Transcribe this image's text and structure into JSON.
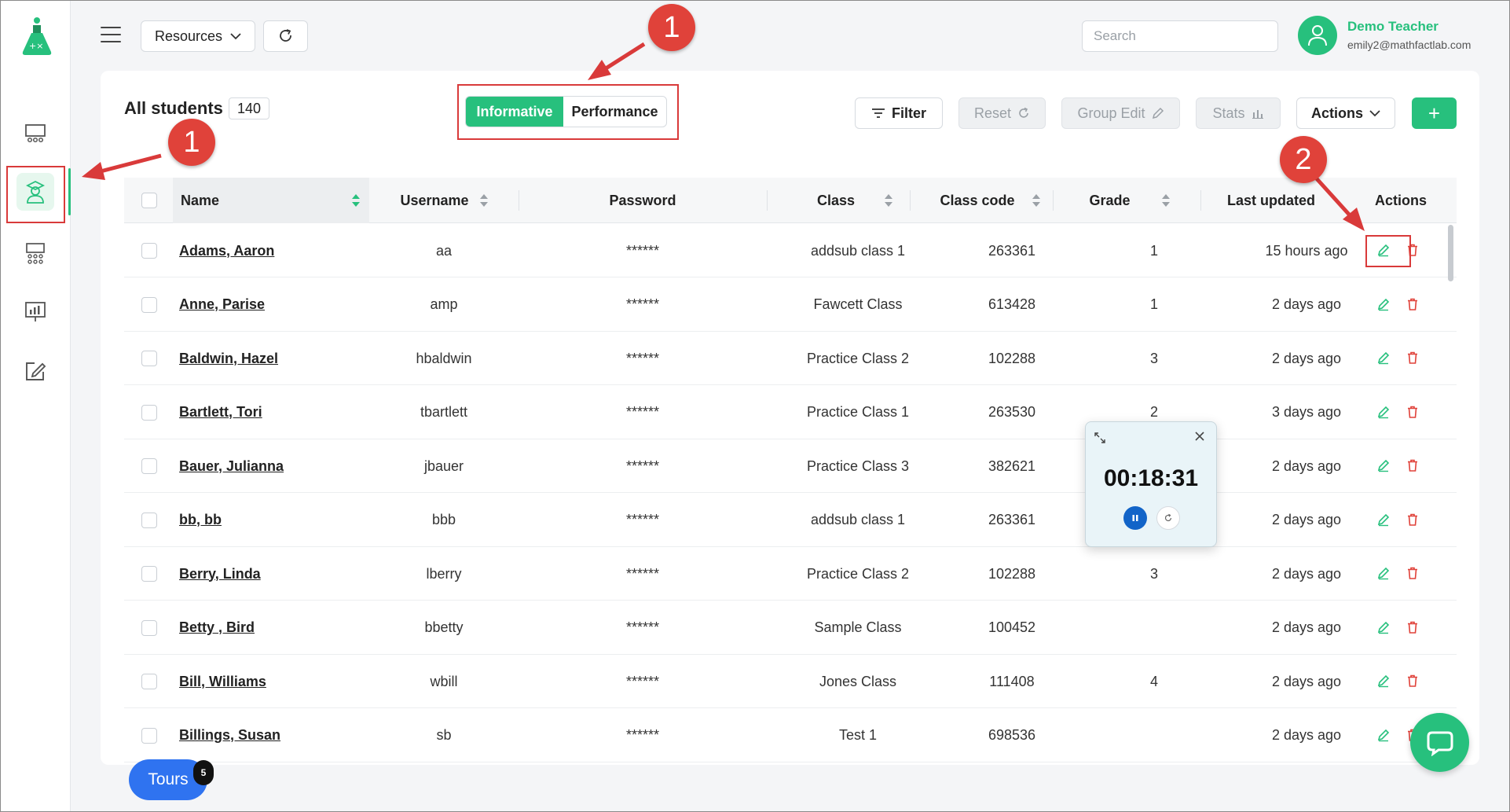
{
  "header": {
    "resources_label": "Resources",
    "search_placeholder": "Search",
    "user_name": "Demo Teacher",
    "user_email": "emily2@mathfactlab.com"
  },
  "students": {
    "title": "All students",
    "count": "140",
    "view_tabs": [
      "Informative",
      "Performance"
    ],
    "active_tab": "Informative"
  },
  "toolbar": {
    "filter": "Filter",
    "reset": "Reset",
    "group_edit": "Group Edit",
    "stats": "Stats",
    "actions": "Actions",
    "add": "+"
  },
  "table": {
    "columns": [
      "Name",
      "Username",
      "Password",
      "Class",
      "Class code",
      "Grade",
      "Last updated",
      "Actions"
    ],
    "rows": [
      {
        "name": "Adams, Aaron",
        "username": "aa",
        "password": "******",
        "class": "addsub class 1",
        "code": "263361",
        "grade": "1",
        "updated": "15 hours ago"
      },
      {
        "name": "Anne, Parise",
        "username": "amp",
        "password": "******",
        "class": "Fawcett Class",
        "code": "613428",
        "grade": "1",
        "updated": "2 days ago"
      },
      {
        "name": "Baldwin, Hazel",
        "username": "hbaldwin",
        "password": "******",
        "class": "Practice Class 2",
        "code": "102288",
        "grade": "3",
        "updated": "2 days ago"
      },
      {
        "name": "Bartlett, Tori",
        "username": "tbartlett",
        "password": "******",
        "class": "Practice Class 1",
        "code": "263530",
        "grade": "2",
        "updated": "3 days ago"
      },
      {
        "name": "Bauer, Julianna",
        "username": "jbauer",
        "password": "******",
        "class": "Practice Class 3",
        "code": "382621",
        "grade": "",
        "updated": "2 days ago"
      },
      {
        "name": "bb, bb",
        "username": "bbb",
        "password": "******",
        "class": "addsub class 1",
        "code": "263361",
        "grade": "",
        "updated": "2 days ago"
      },
      {
        "name": "Berry, Linda",
        "username": "lberry",
        "password": "******",
        "class": "Practice Class 2",
        "code": "102288",
        "grade": "3",
        "updated": "2 days ago"
      },
      {
        "name": "Betty , Bird",
        "username": "bbetty",
        "password": "******",
        "class": "Sample Class",
        "code": "100452",
        "grade": "",
        "updated": "2 days ago"
      },
      {
        "name": "Bill, Williams",
        "username": "wbill",
        "password": "******",
        "class": "Jones Class",
        "code": "111408",
        "grade": "4",
        "updated": "2 days ago"
      },
      {
        "name": "Billings, Susan",
        "username": "sb",
        "password": "******",
        "class": "Test 1",
        "code": "698536",
        "grade": "",
        "updated": "2 days ago"
      }
    ]
  },
  "timer": {
    "value": "00:18:31"
  },
  "tours": {
    "label": "Tours",
    "badge": "5"
  },
  "callouts": {
    "a": "1",
    "b": "1",
    "c": "2"
  },
  "colors": {
    "accent": "#27c07d",
    "danger": "#e0423a",
    "highlight": "#d93a3a",
    "tours": "#2f73f0"
  },
  "icons": {
    "sidebar": [
      "dashboard-icon",
      "students-icon",
      "classes-icon",
      "reports-icon",
      "edit-note-icon"
    ],
    "row_actions": [
      "pencil-icon",
      "trash-icon"
    ]
  }
}
